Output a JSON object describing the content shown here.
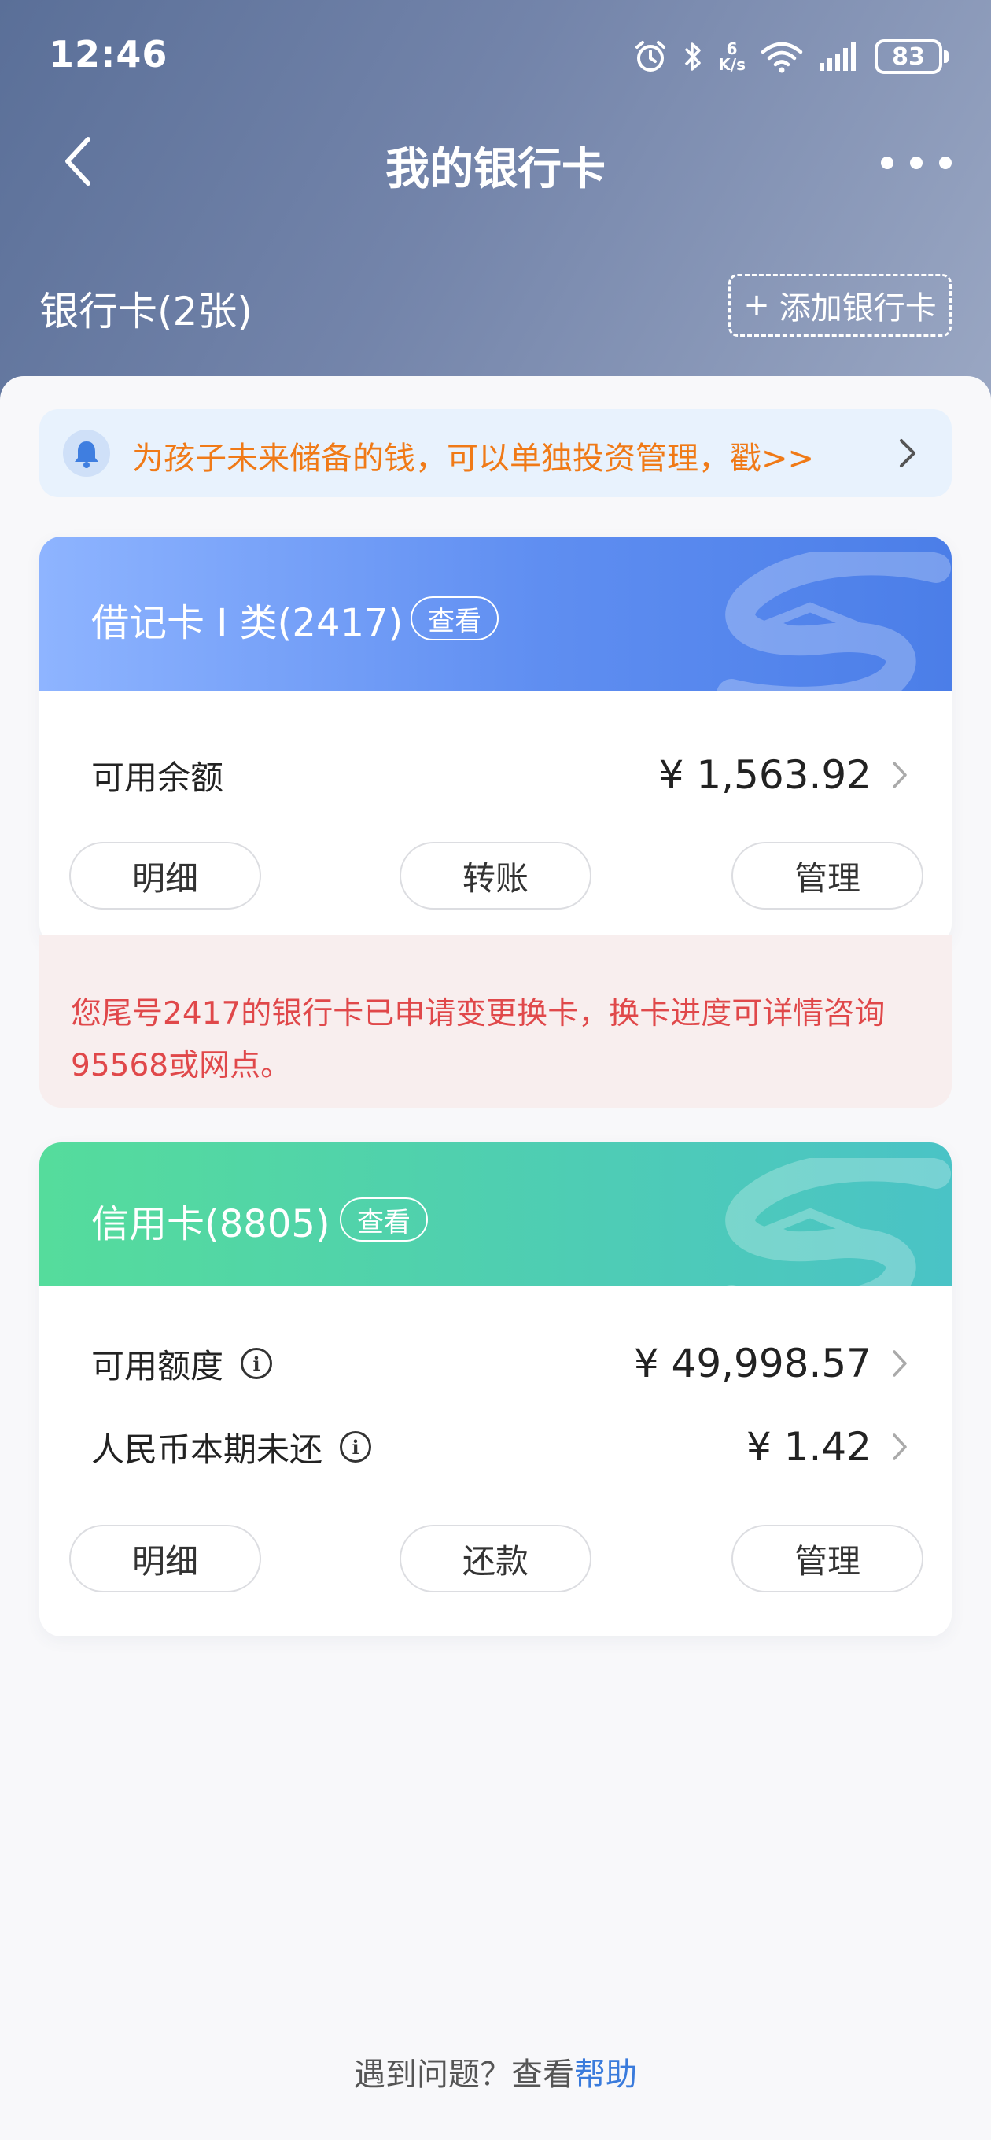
{
  "status_bar": {
    "time": "12:46",
    "speed_top": "6",
    "speed_unit": "K/s",
    "battery": "83"
  },
  "nav": {
    "title": "我的银行卡"
  },
  "cards_header": {
    "count_label": "银行卡(2张)",
    "add_label": "添加银行卡",
    "add_plus": "+"
  },
  "notice": {
    "text": "为孩子未来储备的钱，可以单独投资管理，戳>>"
  },
  "debit_card": {
    "title": "借记卡 I 类(2417)",
    "view_label": "查看",
    "balance_label": "可用余额",
    "balance_value": "¥ 1,563.92",
    "btn_detail": "明细",
    "btn_transfer": "转账",
    "btn_manage": "管理",
    "warning": "您尾号2417的银行卡已申请变更换卡，换卡进度可详情咨询95568或网点。"
  },
  "credit_card": {
    "title": "信用卡(8805)",
    "view_label": "查看",
    "limit_label": "可用额度",
    "limit_value": "¥ 49,998.57",
    "due_label": "人民币本期未还",
    "due_value": "¥ 1.42",
    "btn_detail": "明细",
    "btn_repay": "还款",
    "btn_manage": "管理"
  },
  "footer": {
    "prefix": "遇到问题？查看",
    "link": "帮助"
  },
  "colors": {
    "header_bg": "#6b7ea6",
    "notice_text": "#f07a17",
    "warning_text": "#e0484a",
    "link": "#3a7bdc",
    "debit_gradient": "#5f8ef1",
    "credit_gradient": "#4fcfb0"
  }
}
